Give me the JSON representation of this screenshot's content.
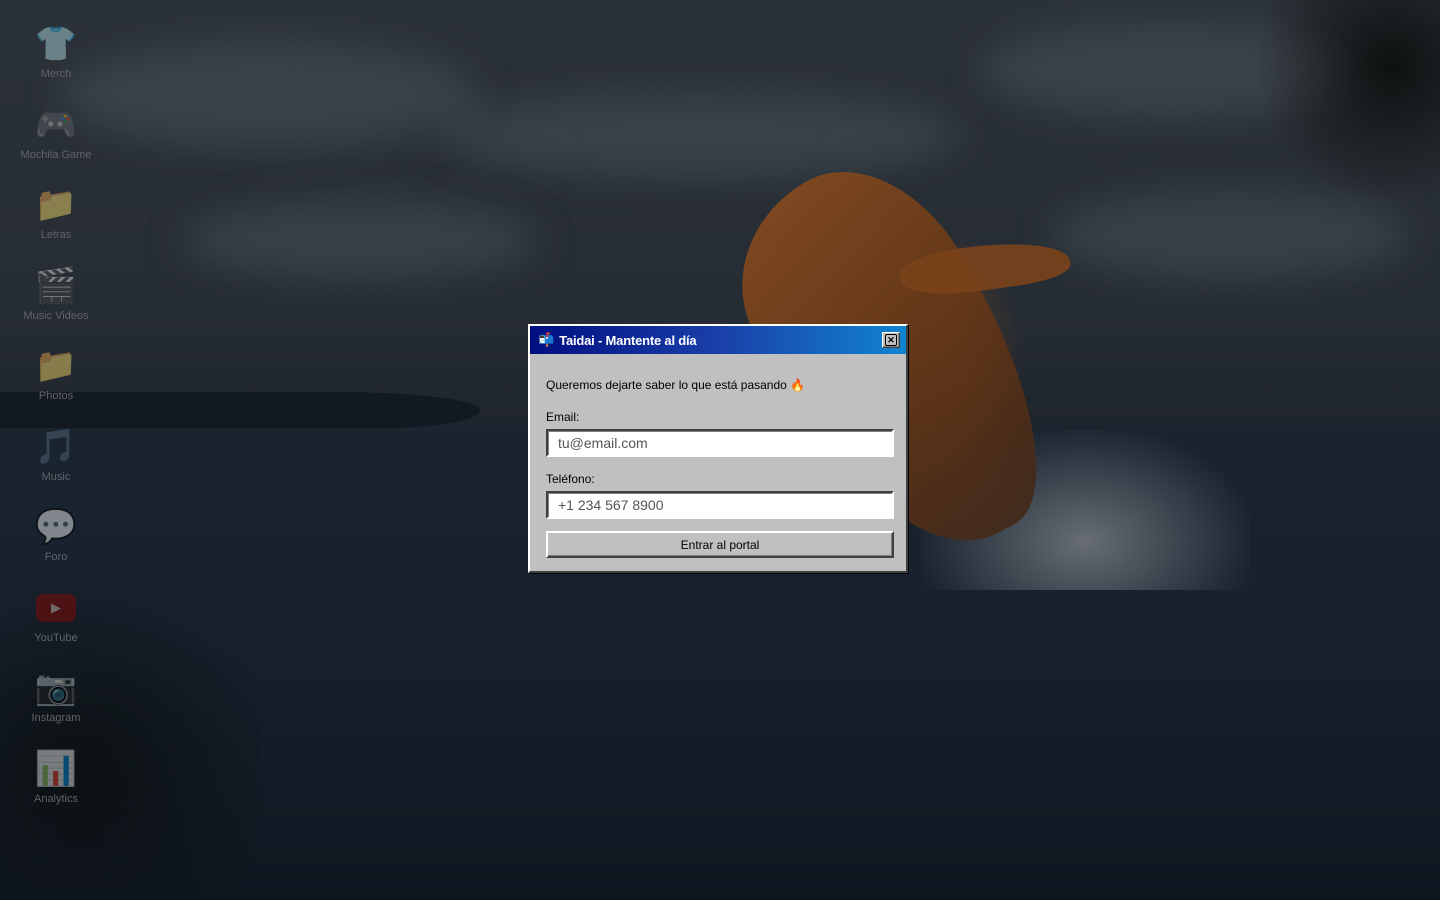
{
  "desktop": {
    "icons": [
      {
        "label": "Merch",
        "icon": "tshirt-icon",
        "glyph": "👕"
      },
      {
        "label": "Mochila Game",
        "icon": "gamepad-icon",
        "glyph": "🎮"
      },
      {
        "label": "Letras",
        "icon": "folder-icon",
        "glyph": "📁"
      },
      {
        "label": "Music Videos",
        "icon": "clapperboard-icon",
        "glyph": "🎬"
      },
      {
        "label": "Photos",
        "icon": "folder-icon",
        "glyph": "📁"
      },
      {
        "label": "Music",
        "icon": "music-note-icon",
        "glyph": "🎵"
      },
      {
        "label": "Foro",
        "icon": "speech-bubble-icon",
        "glyph": "💬"
      },
      {
        "label": "YouTube",
        "icon": "youtube-icon",
        "glyph": "▶"
      },
      {
        "label": "Instagram",
        "icon": "camera-icon",
        "glyph": "📷"
      },
      {
        "label": "Analytics",
        "icon": "bar-chart-icon",
        "glyph": "📊"
      }
    ]
  },
  "dialog": {
    "title_icon": "📬",
    "title": "Taidai - Mantente al día",
    "intro": "Queremos dejarte saber lo que está pasando 🔥",
    "email_label": "Email:",
    "email_placeholder": "tu@email.com",
    "phone_label": "Teléfono:",
    "phone_placeholder": "+1 234 567 8900",
    "submit_label": "Entrar al portal",
    "close_glyph": "✕"
  },
  "colors": {
    "titlebar_start": "#000f80",
    "titlebar_end": "#1084d0",
    "dialog_face": "#c0c0c0"
  }
}
